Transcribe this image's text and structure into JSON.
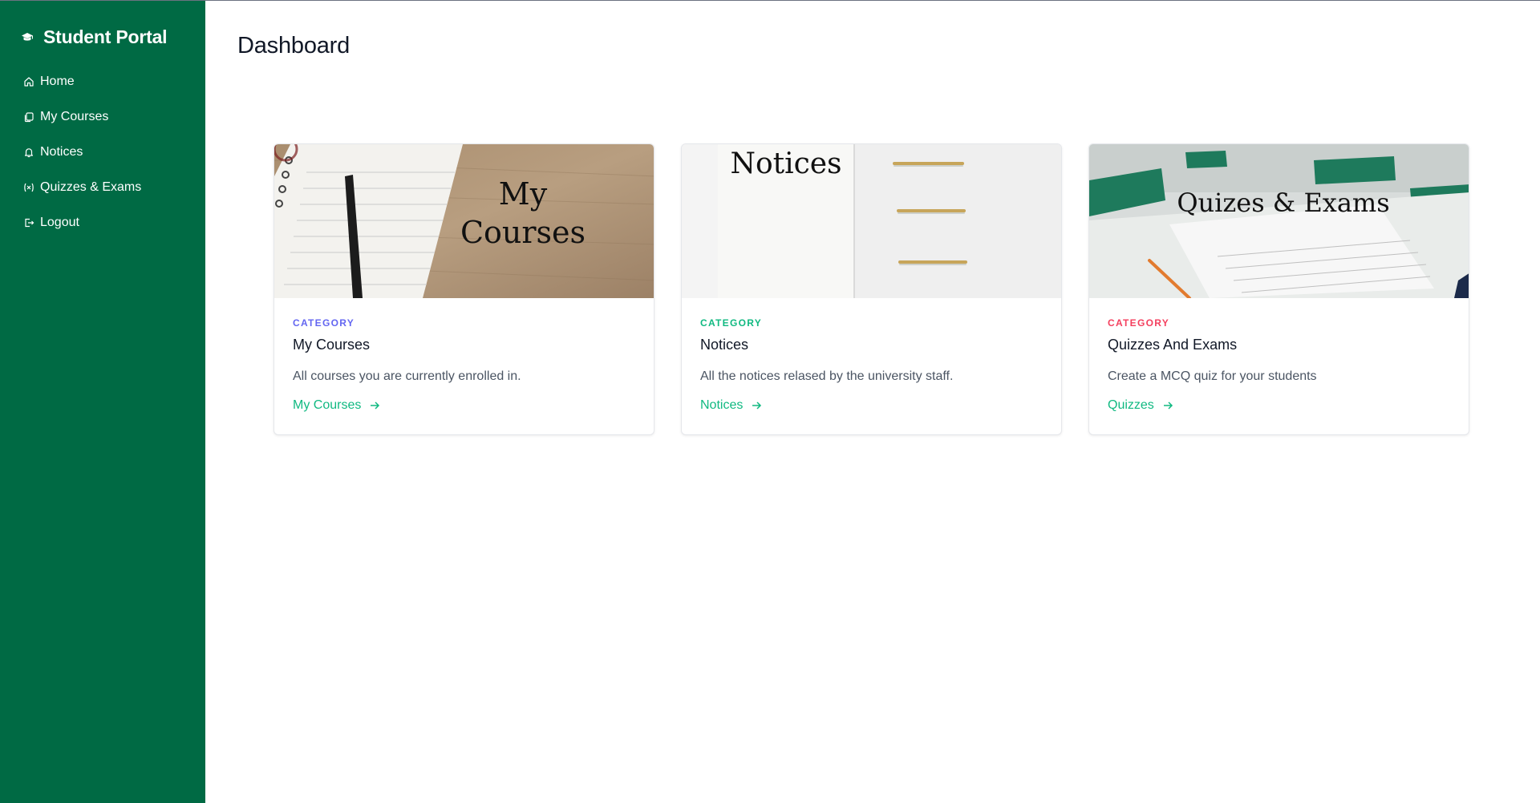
{
  "sidebar": {
    "brand": "Student Portal",
    "items": [
      {
        "label": "Home",
        "icon": "home-icon"
      },
      {
        "label": "My Courses",
        "icon": "copy-icon"
      },
      {
        "label": "Notices",
        "icon": "bell-icon"
      },
      {
        "label": "Quizzes & Exams",
        "icon": "variable-icon"
      },
      {
        "label": "Logout",
        "icon": "logout-icon"
      }
    ],
    "background": "#006a44"
  },
  "main": {
    "title": "Dashboard",
    "cards": [
      {
        "image_text_line1": "My",
        "image_text_line2": "Courses",
        "category": "CATEGORY",
        "category_color": "#6366f1",
        "title": "My Courses",
        "description": "All courses you are currently enrolled in.",
        "link": "My Courses"
      },
      {
        "image_text": "Notices",
        "category": "CATEGORY",
        "category_color": "#10b981",
        "title": "Notices",
        "description": "All the notices relased by the university staff.",
        "link": "Notices"
      },
      {
        "image_text": "Quizes & Exams",
        "category": "CATEGORY",
        "category_color": "#f43f5e",
        "title": "Quizzes And Exams",
        "description": "Create a MCQ quiz for your students",
        "link": "Quizzes"
      }
    ],
    "link_color": "#10b981"
  }
}
